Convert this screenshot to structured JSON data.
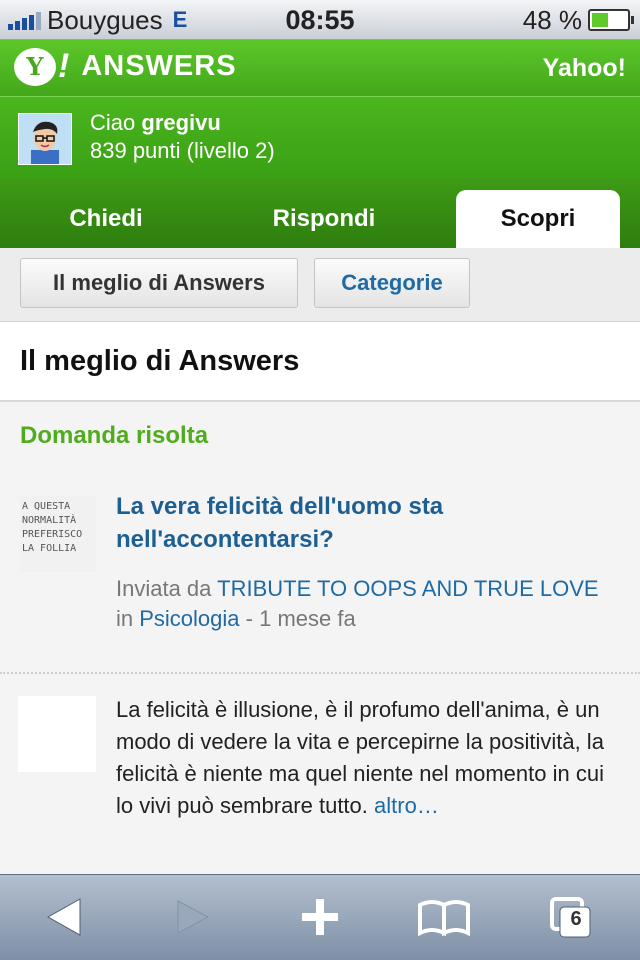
{
  "status_bar": {
    "carrier": "Bouygues",
    "network": "E",
    "time": "08:55",
    "battery_percent": "48 %",
    "battery_level": 0.48
  },
  "header": {
    "logo_mark": "Y",
    "logo_bang": "!",
    "logo_text": "ANSWERS",
    "yahoo_link": "Yahoo!"
  },
  "user": {
    "greeting": "Ciao",
    "username": "gregivu",
    "points": "839 punti (livello 2)"
  },
  "tabs": [
    {
      "label": "Chiedi",
      "active": false
    },
    {
      "label": "Rispondi",
      "active": false
    },
    {
      "label": "Scopri",
      "active": true
    }
  ],
  "subnav": {
    "best": "Il meglio di Answers",
    "categories": "Categorie"
  },
  "page": {
    "title": "Il meglio di Answers",
    "section_label": "Domanda risolta"
  },
  "question": {
    "thumb_text": "A QUESTA NORMALITÀ PREFERISCO LA FOLLIA",
    "title": "La vera felicità dell'uomo sta nell'accontentarsi?",
    "sent_by": "Inviata da",
    "author": "TRIBUTE TO OOPS AND TRUE LOVE",
    "in": "in",
    "category": "Psicologia",
    "time": "- 1 mese fa"
  },
  "answer": {
    "text": "La felicità è illusione, è il profumo dell'anima, è un modo di vedere la vita e percepirne la positività, la felicità è niente ma quel niente nel momento in cui lo vivi può sembrare tutto.",
    "more": "altro…"
  },
  "toolbar": {
    "back_icon": "back-arrow-icon",
    "forward_icon": "forward-arrow-icon",
    "add_icon": "plus-icon",
    "bookmarks_icon": "book-icon",
    "pages_icon": "pages-icon",
    "pages_count": "6"
  },
  "colors": {
    "brand_green": "#4aad1d",
    "tab_green": "#3e9b16",
    "link_blue": "#1e6aa5"
  }
}
